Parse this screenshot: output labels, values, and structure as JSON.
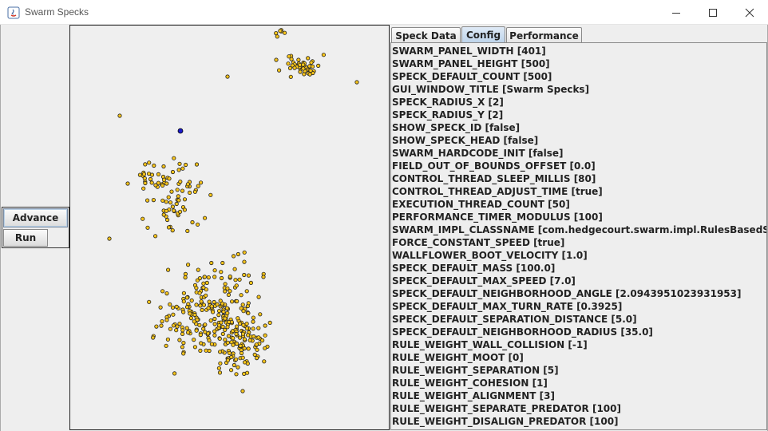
{
  "window": {
    "title": "Swarm Specks",
    "minimize_icon": "minimize-icon",
    "maximize_icon": "maximize-icon",
    "close_icon": "close-icon"
  },
  "buttons": {
    "advance_label": "Advance",
    "run_label": "Run"
  },
  "tabs": [
    {
      "label": "Speck Data",
      "selected": false
    },
    {
      "label": "Config",
      "selected": true
    },
    {
      "label": "Performance",
      "selected": false
    }
  ],
  "config": [
    "SWARM_PANEL_WIDTH [401]",
    "SWARM_PANEL_HEIGHT [500]",
    "SPECK_DEFAULT_COUNT [500]",
    "GUI_WINDOW_TITLE [Swarm Specks]",
    "SPECK_RADIUS_X [2]",
    "SPECK_RADIUS_Y [2]",
    "SHOW_SPECK_ID [false]",
    "SHOW_SPECK_HEAD [false]",
    "SWARM_HARDCODE_INIT [false]",
    "FIELD_OUT_OF_BOUNDS_OFFSET [0.0]",
    "CONTROL_THREAD_SLEEP_MILLIS [80]",
    "CONTROL_THREAD_ADJUST_TIME [true]",
    "EXECUTION_THREAD_COUNT [50]",
    "PERFORMANCE_TIMER_MODULUS [100]",
    "SWARM_IMPL_CLASSNAME [com.hedgecourt.swarm.impl.RulesBasedSwarm]",
    "FORCE_CONSTANT_SPEED [true]",
    "WALLFLOWER_BOOT_VELOCITY [1.0]",
    "SPECK_DEFAULT_MASS [100.0]",
    "SPECK_DEFAULT_MAX_SPEED [7.0]",
    "SPECK_DEFAULT_NEIGHBORHOOD_ANGLE [2.0943951023931953]",
    "SPECK_DEFAULT_MAX_TURN_RATE [0.3925]",
    "SPECK_DEFAULT_SEPARATION_DISTANCE [5.0]",
    "SPECK_DEFAULT_NEIGHBORHOOD_RADIUS [35.0]",
    "RULE_WEIGHT_WALL_COLLISION [-1]",
    "RULE_WEIGHT_MOOT [0]",
    "RULE_WEIGHT_SEPARATION [5]",
    "RULE_WEIGHT_COHESION [1]",
    "RULE_WEIGHT_ALIGNMENT [3]",
    "RULE_WEIGHT_SEPARATE_PREDATOR [100]",
    "RULE_WEIGHT_DISALIGN_PREDATOR [100]"
  ],
  "colors": {
    "speck_fill": "#f7c41a",
    "speck_stroke": "#222222",
    "predator_fill": "#1a1acc",
    "panel_bg": "#efefef"
  },
  "swarm": {
    "speck_count": 500,
    "predator_count": 1
  }
}
